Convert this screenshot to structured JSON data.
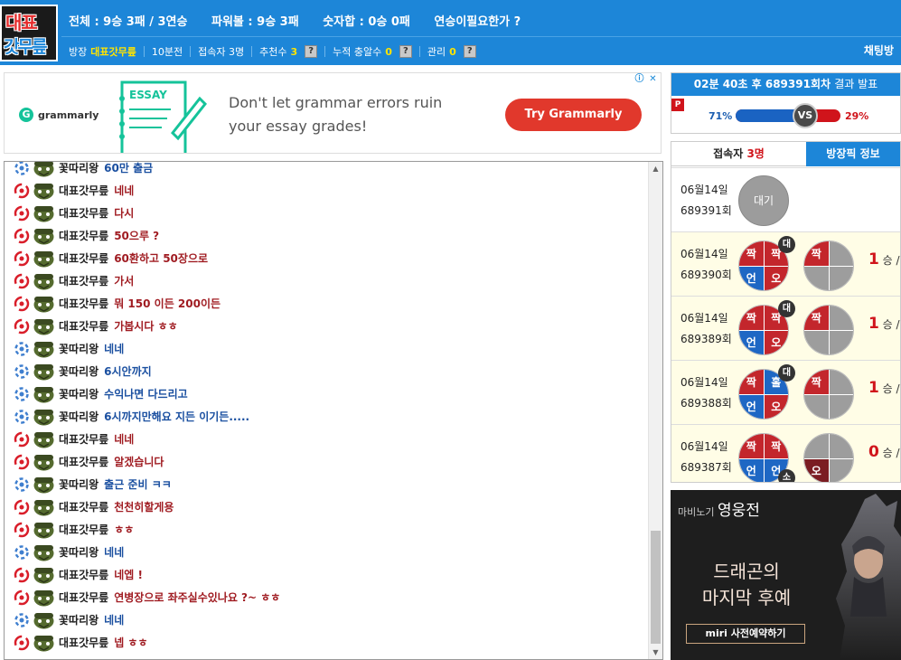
{
  "header": {
    "logo_line1": "대표",
    "logo_line2": "갓무릎",
    "stats": {
      "total": "전체 : 9승 3패 / 3연승",
      "power": "파워볼 : 9승 3패",
      "sum": "숫자합 : 0승 0패",
      "note": "연승이필요한가 ?"
    },
    "room_label": "방장",
    "room_owner": "대표갓무릎",
    "ago": "10분전",
    "users": "접속자 3명",
    "recommend_label": "추천수",
    "recommend_value": "3",
    "cumulative_label": "누적 충알수",
    "cumulative_value": "0",
    "manage_label": "관리",
    "manage_value": "0",
    "help_glyph": "?",
    "chat_room": "채팅방"
  },
  "ad": {
    "brand": "grammarly",
    "headline_line1": "Don't let grammar errors ruin",
    "headline_line2": "your essay grades!",
    "button": "Try Grammarly",
    "essay_label": "ESSAY"
  },
  "chat": {
    "messages": [
      {
        "badge": "blue",
        "nick": "꽃따리왕",
        "text": "60만 출금",
        "color": "blue"
      },
      {
        "badge": "red",
        "nick": "대표갓무릎",
        "text": "네네",
        "color": "red"
      },
      {
        "badge": "red",
        "nick": "대표갓무릎",
        "text": "다시",
        "color": "red"
      },
      {
        "badge": "red",
        "nick": "대표갓무릎",
        "text": "50으루 ?",
        "color": "red"
      },
      {
        "badge": "red",
        "nick": "대표갓무릎",
        "text": "60환하고 50장으로",
        "color": "red"
      },
      {
        "badge": "red",
        "nick": "대표갓무릎",
        "text": "가서",
        "color": "red"
      },
      {
        "badge": "red",
        "nick": "대표갓무릎",
        "text": "뭐 150 이든 200이든",
        "color": "red"
      },
      {
        "badge": "red",
        "nick": "대표갓무릎",
        "text": "가봅시다 ㅎㅎ",
        "color": "red"
      },
      {
        "badge": "blue",
        "nick": "꽃따리왕",
        "text": "네네",
        "color": "blue"
      },
      {
        "badge": "blue",
        "nick": "꽃따리왕",
        "text": "6시안까지",
        "color": "blue"
      },
      {
        "badge": "blue",
        "nick": "꽃따리왕",
        "text": "수익나면 다드리고",
        "color": "blue"
      },
      {
        "badge": "blue",
        "nick": "꽃따리왕",
        "text": "6시까지만해요 지든 이기든.....",
        "color": "blue"
      },
      {
        "badge": "red",
        "nick": "대표갓무릎",
        "text": "네네",
        "color": "red"
      },
      {
        "badge": "red",
        "nick": "대표갓무릎",
        "text": "알겠습니다",
        "color": "red"
      },
      {
        "badge": "blue",
        "nick": "꽃따리왕",
        "text": "출근 준비 ㅋㅋ",
        "color": "blue"
      },
      {
        "badge": "red",
        "nick": "대표갓무릎",
        "text": "천천히할게용",
        "color": "red"
      },
      {
        "badge": "red",
        "nick": "대표갓무릎",
        "text": "ㅎㅎ",
        "color": "red"
      },
      {
        "badge": "blue",
        "nick": "꽃따리왕",
        "text": "네네",
        "color": "blue"
      },
      {
        "badge": "red",
        "nick": "대표갓무릎",
        "text": "네엡 !",
        "color": "red"
      },
      {
        "badge": "red",
        "nick": "대표갓무릎",
        "text": "연병장으로 좌주실수있나요 ?~ ㅎㅎ",
        "color": "red"
      },
      {
        "badge": "blue",
        "nick": "꽃따리왕",
        "text": "네네",
        "color": "blue"
      },
      {
        "badge": "red",
        "nick": "대표갓무릎",
        "text": "넵 ㅎㅎ",
        "color": "red"
      }
    ]
  },
  "result": {
    "time_prefix": "02분 40초 후",
    "round": "689391회차",
    "suffix": "결과 발표",
    "p_badge": "P",
    "left_pct": "71%",
    "right_pct": "29%",
    "left_fraction": 0.71,
    "vs": "VS"
  },
  "panel": {
    "tab_users_prefix": "접속자",
    "tab_users_count": "3명",
    "tab_owner": "방장픽 정보",
    "rows": [
      {
        "date": "06월14일",
        "round": "689391회",
        "wait": "대기"
      },
      {
        "date": "06월14일",
        "round": "689390회",
        "pie1": [
          "짝",
          "짝",
          "언",
          "오"
        ],
        "pie1_colors": [
          "R",
          "R",
          "B",
          "R"
        ],
        "tag": "대",
        "pie2": [
          "짝",
          "",
          "",
          ""
        ],
        "pie2_colors": [
          "R",
          "G",
          "G",
          "G"
        ],
        "rec_num": "1",
        "rec_text": "승 / 0"
      },
      {
        "date": "06월14일",
        "round": "689389회",
        "pie1": [
          "짝",
          "짝",
          "언",
          "오"
        ],
        "pie1_colors": [
          "R",
          "R",
          "B",
          "R"
        ],
        "tag": "대",
        "pie2": [
          "짝",
          "",
          "",
          ""
        ],
        "pie2_colors": [
          "R",
          "G",
          "G",
          "G"
        ],
        "rec_num": "1",
        "rec_text": "승 / 0"
      },
      {
        "date": "06월14일",
        "round": "689388회",
        "pie1": [
          "짝",
          "홀",
          "언",
          "오"
        ],
        "pie1_colors": [
          "R",
          "B",
          "B",
          "R"
        ],
        "tag": "대",
        "pie2": [
          "짝",
          "",
          "",
          ""
        ],
        "pie2_colors": [
          "R",
          "G",
          "G",
          "G"
        ],
        "rec_num": "1",
        "rec_text": "승 / 0"
      },
      {
        "date": "06월14일",
        "round": "689387회",
        "pie1": [
          "짝",
          "짝",
          "언",
          "언"
        ],
        "pie1_colors": [
          "R",
          "R",
          "B",
          "B"
        ],
        "tag": "소",
        "pie2": [
          "",
          "",
          "오",
          ""
        ],
        "pie2_colors": [
          "G",
          "G",
          "D",
          "G"
        ],
        "rec_num": "0",
        "rec_text": "승 / 1"
      }
    ]
  },
  "banner": {
    "brand_small": "마비노기",
    "brand_big": "영웅전",
    "line1": "드래곤의",
    "line2": "마지막 후예",
    "cta": "miri 사전예약하기"
  }
}
